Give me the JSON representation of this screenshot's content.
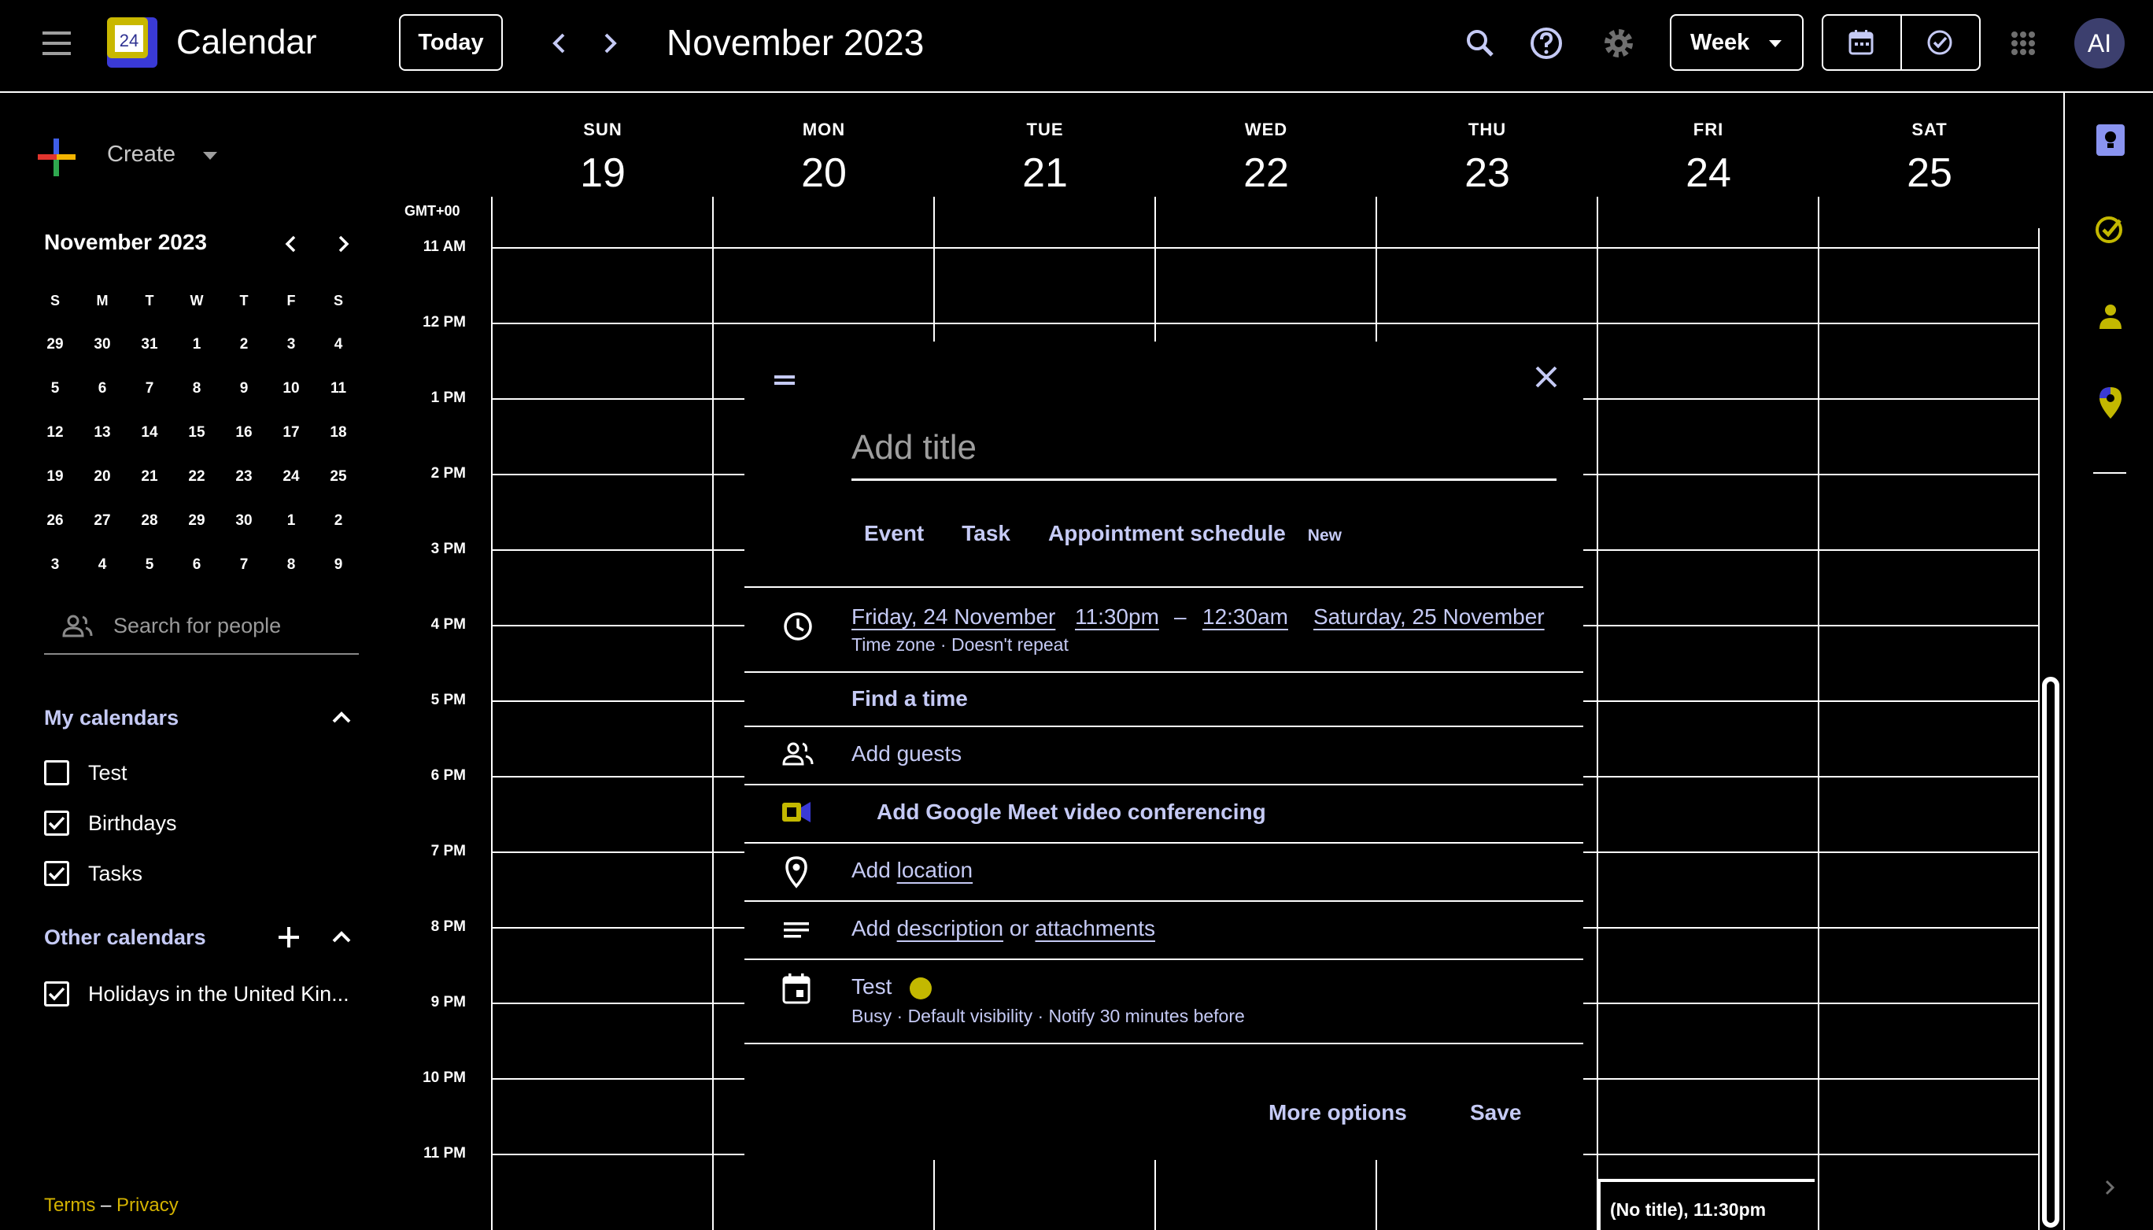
{
  "header": {
    "app_title": "Calendar",
    "logo_day": "24",
    "today_label": "Today",
    "period_title": "November 2023",
    "view_label": "Week",
    "avatar_initials": "AI"
  },
  "sidebar": {
    "create_label": "Create",
    "mini_calendar": {
      "title": "November 2023",
      "weekday_headers": [
        "S",
        "M",
        "T",
        "W",
        "T",
        "F",
        "S"
      ],
      "weeks": [
        [
          "29",
          "30",
          "31",
          "1",
          "2",
          "3",
          "4"
        ],
        [
          "5",
          "6",
          "7",
          "8",
          "9",
          "10",
          "11"
        ],
        [
          "12",
          "13",
          "14",
          "15",
          "16",
          "17",
          "18"
        ],
        [
          "19",
          "20",
          "21",
          "22",
          "23",
          "24",
          "25"
        ],
        [
          "26",
          "27",
          "28",
          "29",
          "30",
          "1",
          "2"
        ],
        [
          "3",
          "4",
          "5",
          "6",
          "7",
          "8",
          "9"
        ]
      ]
    },
    "search_people_placeholder": "Search for people",
    "my_calendars": {
      "heading": "My calendars",
      "items": [
        {
          "label": "Test",
          "checked": false
        },
        {
          "label": "Birthdays",
          "checked": true
        },
        {
          "label": "Tasks",
          "checked": true
        }
      ]
    },
    "other_calendars": {
      "heading": "Other calendars",
      "items": [
        {
          "label": "Holidays in the United Kin...",
          "checked": true
        }
      ]
    },
    "footer": {
      "terms": "Terms",
      "separator": "–",
      "privacy": "Privacy"
    }
  },
  "grid": {
    "timezone": "GMT+00",
    "days": [
      {
        "dow": "SUN",
        "num": "19"
      },
      {
        "dow": "MON",
        "num": "20"
      },
      {
        "dow": "TUE",
        "num": "21"
      },
      {
        "dow": "WED",
        "num": "22"
      },
      {
        "dow": "THU",
        "num": "23"
      },
      {
        "dow": "FRI",
        "num": "24"
      },
      {
        "dow": "SAT",
        "num": "25"
      }
    ],
    "hours": [
      "11 AM",
      "12 PM",
      "1 PM",
      "2 PM",
      "3 PM",
      "4 PM",
      "5 PM",
      "6 PM",
      "7 PM",
      "8 PM",
      "9 PM",
      "10 PM",
      "11 PM"
    ],
    "event_chip": {
      "title": "(No title)",
      "time": ", 11:30pm"
    }
  },
  "dialog": {
    "title_placeholder": "Add title",
    "tabs": [
      "Event",
      "Task",
      "Appointment schedule"
    ],
    "new_badge": "New",
    "start_date": "Friday, 24 November",
    "start_time": "11:30pm",
    "dash": "–",
    "end_time": "12:30am",
    "end_date": "Saturday, 25 November",
    "timezone_repeat": "Time zone · Doesn't repeat",
    "find_time": "Find a time",
    "add_guests": "Add guests",
    "meet": "Add Google Meet video conferencing",
    "add_prefix": "Add ",
    "location": "location",
    "description": "description",
    "or": " or ",
    "attachments": "attachments",
    "calendar_name": "Test",
    "calendar_color": "#c3b800",
    "calendar_details": "Busy · Default visibility · Notify 30 minutes before",
    "more_options": "More options",
    "save": "Save"
  },
  "colors": {
    "accent_text": "#c5caf5",
    "footer_link": "#d4b300",
    "avatar_bg": "#3c3f6e"
  }
}
